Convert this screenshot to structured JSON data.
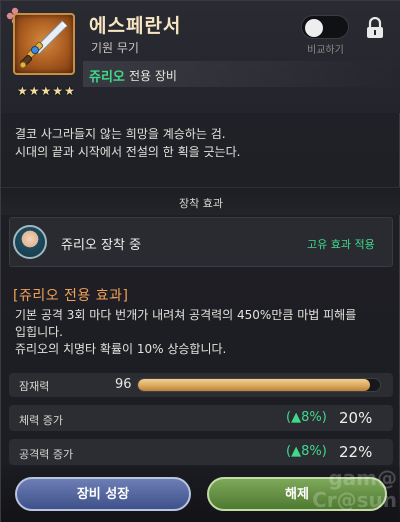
{
  "item": {
    "name": "에스페란서",
    "type": "기원 무기",
    "exclusive_hero": "쥬리오",
    "exclusive_label": "전용 장비",
    "stars": [
      "★",
      "★",
      "★",
      "★",
      "★"
    ],
    "icon": "sword-icon",
    "frame_color": "#c98f45"
  },
  "header": {
    "compare_label": "비교하기",
    "compare_on": false,
    "lock_icon": "lock-icon",
    "corner_icon": "flower-icon"
  },
  "description": [
    "결코 사그라들지 않는 희망을 계승하는 검.",
    "시대의 끝과 시작에서 전설의 한 획을 긋는다."
  ],
  "equip": {
    "section_title": "장착 효과",
    "status_text": "쥬리오 장착 중",
    "unique_applied": "고유 효과 적용"
  },
  "exclusive_effect": {
    "title": "[쥬리오 전용 효과]",
    "lines": [
      "기본 공격 3회 마다 번개가 내려쳐 공격력의 450%만큼 마법 피해를",
      "입힙니다.",
      "쥬리오의 치명타 확률이 10% 상승합니다."
    ]
  },
  "stats": {
    "potential": {
      "label": "잠재력",
      "value": "96",
      "fill_fraction": 0.96
    },
    "rows": [
      {
        "label": "체력 증가",
        "bonus": "(▲8%)",
        "value": "20%"
      },
      {
        "label": "공격력 증가",
        "bonus": "(▲8%)",
        "value": "22%"
      }
    ]
  },
  "buttons": {
    "grow": "장비 성장",
    "unequip": "해제"
  },
  "colors": {
    "accent_green": "#3fd98a",
    "accent_orange": "#f0a058",
    "gold": "#d8a55a"
  },
  "watermark": {
    "line1": "gam@",
    "line2": "Cr@sun"
  }
}
